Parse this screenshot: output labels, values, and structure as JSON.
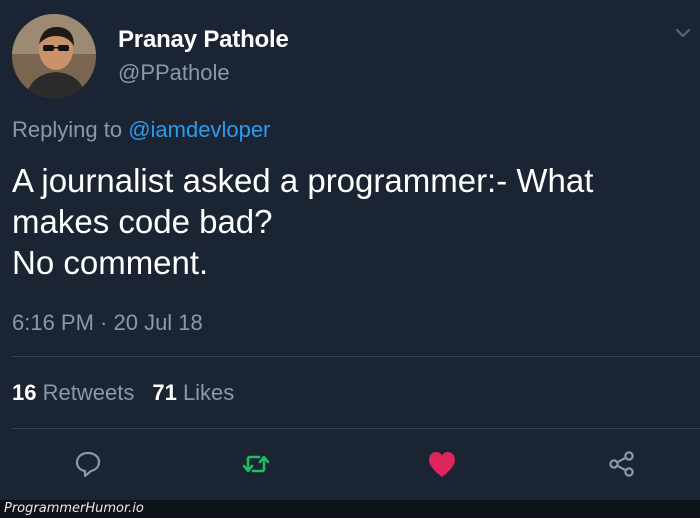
{
  "tweet": {
    "display_name": "Pranay Pathole",
    "handle": "@PPathole",
    "replying_prefix": "Replying to",
    "replying_to": "@iamdevloper",
    "text_lines": [
      "A journalist asked a programmer:- What",
      "makes code bad?",
      "No comment."
    ],
    "timestamp": "6:16 PM · 20 Jul 18",
    "retweets_count": "16",
    "retweets_label": "Retweets",
    "likes_count": "71",
    "likes_label": "Likes"
  },
  "icons": {
    "reply": "reply-icon",
    "retweet": "retweet-icon",
    "like": "heart-icon",
    "share": "share-icon",
    "menu": "chevron-down-icon"
  },
  "colors": {
    "background": "#1b2433",
    "mention": "#2b9bf0",
    "retweet": "#19bf63",
    "like": "#e0245e",
    "muted": "#8b98a8"
  },
  "watermark": "ProgrammerHumor.io"
}
